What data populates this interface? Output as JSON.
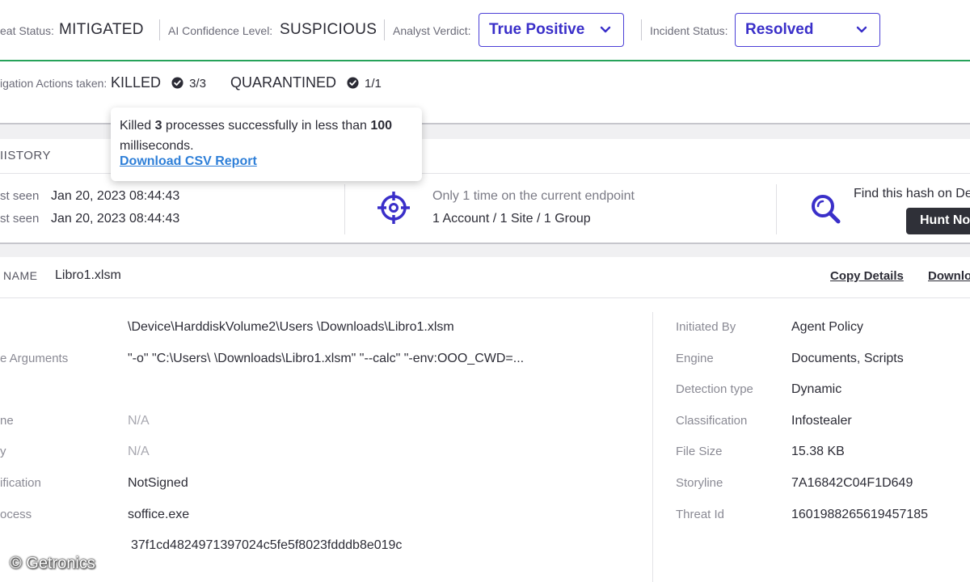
{
  "status_bar": {
    "threat_status_label": "eat Status:",
    "threat_status_value": "MITIGATED",
    "ai_confidence_label": "AI Confidence Level:",
    "ai_confidence_value": "SUSPICIOUS",
    "analyst_verdict_label": "Analyst Verdict:",
    "analyst_verdict_value": "True Positive",
    "incident_status_label": "Incident Status:",
    "incident_status_value": "Resolved",
    "accent_color": "#4b3fd6",
    "divider_color": "#27a35a"
  },
  "mitigation": {
    "label": "igation Actions taken:",
    "actions": [
      {
        "name": "KILLED",
        "count": "3/3",
        "icon": "check-circle-icon"
      },
      {
        "name": "QUARANTINED",
        "count": "1/1",
        "icon": "check-circle-icon"
      }
    ]
  },
  "tooltip": {
    "text_before": "Killed ",
    "count": "3",
    "text_middle": " processes successfully in less than ",
    "ms": "100",
    "text_end": "milliseconds.",
    "link": "Download CSV Report"
  },
  "history": {
    "title": "IISTORY",
    "first_seen_label": "st seen",
    "first_seen_value": "Jan 20, 2023 08:44:43",
    "last_seen_label": "st seen",
    "last_seen_value": "Jan 20, 2023 08:44:43",
    "endpoint_text": "Only 1 time on the current endpoint",
    "scope_text": "1 Account / 1 Site / 1 Group",
    "find_hash_text": "Find this hash on De",
    "hunt_button": "Hunt No",
    "icon_color": "#3a2fc9"
  },
  "details": {
    "name_label": "NAME",
    "name_value": "Libro1.xlsm",
    "copy_details": "Copy Details",
    "download": "Downlo",
    "left_rows": [
      {
        "label": "",
        "value": "\\Device\\HarddiskVolume2\\Users          \\Downloads\\Libro1.xlsm",
        "na": false
      },
      {
        "label": "e Arguments",
        "value": "\"-o\" \"C:\\Users\\          \\Downloads\\Libro1.xlsm\" \"--calc\" \"-env:OOO_CWD=...",
        "na": false
      },
      {
        "label": "ne",
        "value": "N/A",
        "na": true
      },
      {
        "label": "y",
        "value": "N/A",
        "na": true
      },
      {
        "label": "ification",
        "value": "NotSigned",
        "na": false
      },
      {
        "label": "ocess",
        "value": "soffice.exe",
        "na": false
      },
      {
        "label": "",
        "value": "37f1cd4824971397024c5fe5f8023fdddb8e019c",
        "na": false
      }
    ],
    "right_rows": [
      {
        "label": "Initiated By",
        "value": "Agent Policy"
      },
      {
        "label": "Engine",
        "value": "Documents, Scripts"
      },
      {
        "label": "Detection type",
        "value": "Dynamic"
      },
      {
        "label": "Classification",
        "value": "Infostealer"
      },
      {
        "label": "File Size",
        "value": "15.38 KB"
      },
      {
        "label": "Storyline",
        "value": "7A16842C04F1D649"
      },
      {
        "label": "Threat Id",
        "value": "1601988265619457185"
      }
    ]
  },
  "watermark": "© Getronics"
}
